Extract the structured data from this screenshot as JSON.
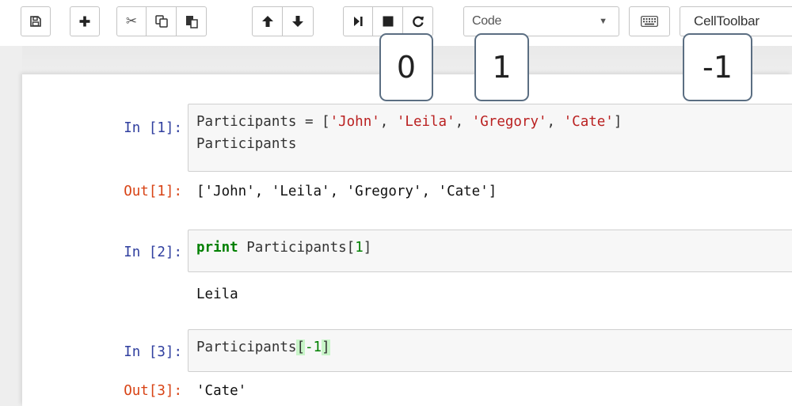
{
  "toolbar": {
    "buttons": [
      "save-icon",
      "add-icon",
      "cut-icon",
      "copy-icon",
      "paste-icon",
      "move-up-icon",
      "move-down-icon",
      "run-icon",
      "stop-icon",
      "restart-icon",
      "keyboard-icon"
    ],
    "cell_type": "Code",
    "celltoolbar_label": "CellToolbar"
  },
  "annotations": [
    "0",
    "1",
    "-1"
  ],
  "cells": [
    {
      "in_prompt": "In [1]:",
      "line1": {
        "var": "Participants = [",
        "items": [
          "'John'",
          "'Leila'",
          "'Gregory'",
          "'Cate'"
        ],
        "sep": ", ",
        "close": "]"
      },
      "line2": "Participants",
      "out_prompt": "Out[1]:",
      "output": "['John', 'Leila', 'Gregory', 'Cate']"
    },
    {
      "in_prompt": "In [2]:",
      "keyword": "print",
      "code_pre": " Participants[",
      "index": "1",
      "code_post": "]",
      "output": "Leila"
    },
    {
      "in_prompt": "In [3]:",
      "code_pre": "Participants",
      "open": "[",
      "index": "-1",
      "close": "]",
      "out_prompt": "Out[3]:",
      "output": "'Cate'"
    }
  ]
}
